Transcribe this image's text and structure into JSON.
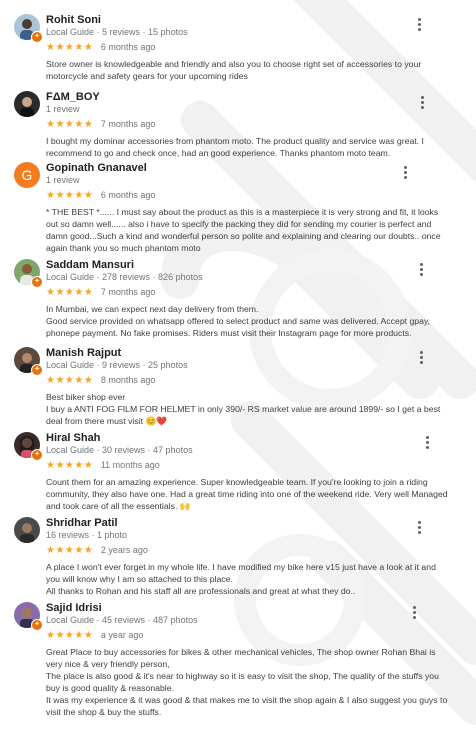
{
  "reviews": [
    {
      "name": "Rohit Soni",
      "meta": "Local Guide · 5 reviews · 15 photos",
      "stars": "★★★★★",
      "time": "6 months ago",
      "lines": [
        "Store owner is knowledgeable and friendly and also you to choose right set  of accessories to your",
        "motorcycle and safety gears for your upcoming rides"
      ]
    },
    {
      "name": "FΔM_BOY",
      "meta": "1 review",
      "stars": "★★★★★",
      "time": "7 months ago",
      "lines": [
        "I bought my dominar accessories from phantom moto. The product quality and service was great. I",
        "recommend to go and check once, had an good experience. Thanks phantom moto team."
      ]
    },
    {
      "name": "Gopinath Gnanavel",
      "avatar_letter": "G",
      "meta": "1 review",
      "stars": "★★★★★",
      "time": "6 months ago",
      "lines": [
        "* THE BEST *...... I must say about the product as this is a masterpiece it is very strong and fit, it looks",
        "out so damn well...... also i have to specify the packing they did for sending my courier is perfect and",
        "damn good...Such a kind and wonderful person so polite and explaining and clearing our doubts.. once",
        "again thank you so much phantom moto"
      ]
    },
    {
      "name": "Saddam Mansuri",
      "meta": "Local Guide · 278 reviews · 826 photos",
      "stars": "★★★★★",
      "time": "7 months ago",
      "lines": [
        "In Mumbai, we can expect next day delivery from them.",
        "Good service provided on whatsapp offered to select product and same was delivered.  Accept gpay,",
        "phonepe payment. No fake promises. Riders must visit their Instagram page for more products."
      ]
    },
    {
      "name": "Manish Rajput",
      "meta": "Local Guide · 9 reviews · 25 photos",
      "stars": "★★★★★",
      "time": "8 months ago",
      "lines": [
        "Best biker shop ever",
        "I buy a ANTI FOG FILM FOR HELMET in only 390/- RS market value are around 1899/- so I get a best",
        "deal from there must visit 😊❤️"
      ]
    },
    {
      "name": "Hiral Shah",
      "meta": "Local Guide · 30 reviews · 47 photos",
      "stars": "★★★★★",
      "time": "11 months ago",
      "lines": [
        "Count them for an amazing experience. Super knowledgeable team. If you're looking to join a riding",
        "community, they also have one. Had a great time riding into one of the weekend ride. Very well Managed",
        "and took care of all the essentials. 🙌"
      ]
    },
    {
      "name": "Shridhar Patil",
      "meta": "16 reviews · 1 photo",
      "stars": "★★★★★",
      "time": "2 years ago",
      "lines": [
        "A place I won't ever forget in my whole life. I have modified my bike here v15 just have a look at it and",
        "you will know why I am so attached to this place.",
        "All thanks to Rohan and his staff all are professionals and great at what they do.."
      ]
    },
    {
      "name": "Sajid Idrisi",
      "meta": "Local Guide · 45 reviews · 487 photos",
      "stars": "★★★★★",
      "time": "a year ago",
      "lines": [
        "Great Place to buy accessories for bikes & other mechanical vehicles, The shop owner Rohan Bhai is",
        "very nice & very friendly person,",
        "The place is also good & it's near to highway so it is easy to visit the shop, The quality of the  stuffs you",
        "buy is good quality & reasonable.",
        "It was my experience & it was good & that makes me to visit the shop again & I also suggest you guys to",
        "visit the shop & buy the stuffs."
      ]
    }
  ]
}
